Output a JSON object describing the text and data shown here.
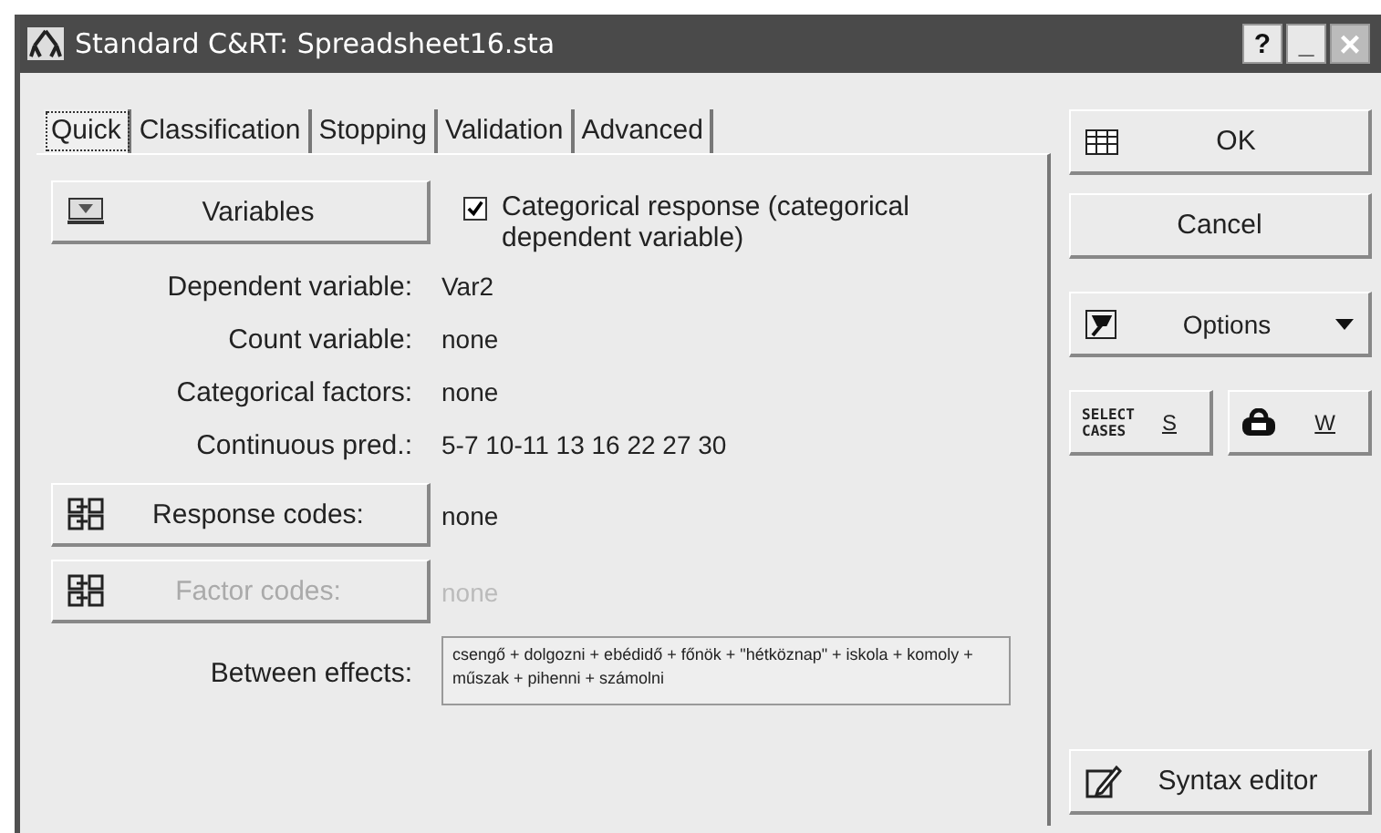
{
  "window": {
    "title": "Standard C&RT: Spreadsheet16.sta",
    "controls": [
      "?",
      "_",
      "×"
    ]
  },
  "tabs": [
    {
      "label": "Quick",
      "selected": true
    },
    {
      "label": "Classification",
      "selected": false
    },
    {
      "label": "Stopping",
      "selected": false
    },
    {
      "label": "Validation",
      "selected": false
    },
    {
      "label": "Advanced",
      "selected": false
    }
  ],
  "variables_button": {
    "label": "Variables"
  },
  "categorical_response": {
    "label": "Categorical response (categorical dependent variable)",
    "checked": true
  },
  "fields": [
    {
      "label": "Dependent variable:",
      "value": "Var2"
    },
    {
      "label": "Count variable:",
      "value": "none"
    },
    {
      "label": "Categorical factors:",
      "value": "none"
    },
    {
      "label": "Continuous pred.:",
      "value": "5-7 10-11 13 16 22 27 30"
    }
  ],
  "code_buttons": [
    {
      "label": "Response codes:",
      "value": "none",
      "disabled": false
    },
    {
      "label": "Factor codes:",
      "value": "none",
      "disabled": true
    }
  ],
  "between_effects": {
    "label": "Between effects:",
    "value": "csengő + dolgozni + ebédidő + főnök + \"hétköznap\" + iskola + komoly + műszak + pihenni + számolni"
  },
  "side_buttons": {
    "ok": "OK",
    "cancel": "Cancel",
    "options": "Options",
    "select_cases": [
      "SELECT",
      "CASES"
    ],
    "select_key": "S",
    "weight_key": "W",
    "syntax": "Syntax editor"
  }
}
